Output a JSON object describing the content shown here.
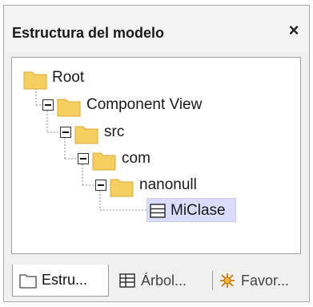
{
  "panel": {
    "title": "Estructura del modelo",
    "close_symbol": "×"
  },
  "tree": {
    "nodes": [
      {
        "label": "Root",
        "icon": "folder-icon",
        "expanded": true
      },
      {
        "label": "Component View",
        "icon": "folder-icon",
        "expanded": true
      },
      {
        "label": "src",
        "icon": "folder-icon",
        "expanded": true
      },
      {
        "label": "com",
        "icon": "folder-icon",
        "expanded": true
      },
      {
        "label": "nanonull",
        "icon": "folder-icon",
        "expanded": true
      },
      {
        "label": "MiClase",
        "icon": "class-icon",
        "selected": true
      }
    ]
  },
  "tabs": [
    {
      "label": "Estru...",
      "icon": "folder-outline-icon",
      "active": true
    },
    {
      "label": "Árbol...",
      "icon": "tree-icon",
      "active": false
    },
    {
      "label": "Favor...",
      "icon": "star-icon",
      "active": false
    }
  ],
  "colors": {
    "folder": "#f6cf62",
    "selection": "#d9dcfb",
    "tree_lines": "#8c8c8c"
  }
}
